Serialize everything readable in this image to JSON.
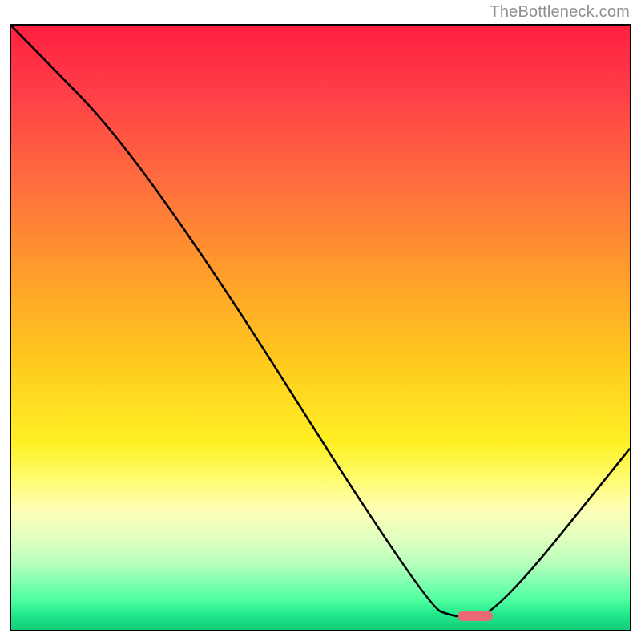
{
  "watermark": "TheBottleneck.com",
  "chart_data": {
    "type": "line",
    "title": "",
    "xlabel": "",
    "ylabel": "",
    "xlim": [
      0,
      100
    ],
    "ylim": [
      0,
      100
    ],
    "grid": false,
    "legend": false,
    "curve": {
      "name": "bottleneck-curve",
      "points": [
        {
          "x": 0,
          "y": 100
        },
        {
          "x": 22,
          "y": 77
        },
        {
          "x": 67,
          "y": 4
        },
        {
          "x": 72,
          "y": 2
        },
        {
          "x": 78,
          "y": 2
        },
        {
          "x": 100,
          "y": 30
        }
      ]
    },
    "optimal_marker": {
      "x": 75,
      "y": 2.3
    },
    "gradient_stops": [
      {
        "pos": 0,
        "color": "#ff2040"
      },
      {
        "pos": 50,
        "color": "#ffd020"
      },
      {
        "pos": 80,
        "color": "#ffffa0"
      },
      {
        "pos": 100,
        "color": "#13cc79"
      }
    ]
  }
}
